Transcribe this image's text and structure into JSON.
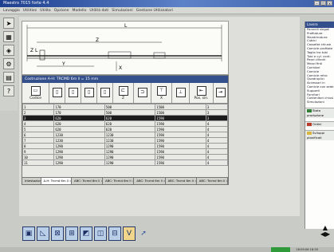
{
  "window": {
    "title": "Maestro 7015 forte 4.4"
  },
  "menu": {
    "items": [
      "Lavaggio",
      "Utilities",
      "Utilita",
      "Opzione",
      "Modello",
      "Utilità dati",
      "Simulazioni",
      "Gestione Utilizzatori"
    ]
  },
  "toolbar": {
    "icons": [
      "cursor-icon",
      "select-icon",
      "layers-icon",
      "settings-icon",
      "report-icon",
      "help-icon"
    ]
  },
  "drawing": {
    "dimension_labels": {
      "L": "L",
      "Z": "Z",
      "Y": "Y",
      "X": "X",
      "ZL": "Z L"
    }
  },
  "panel": {
    "title": "Costruzione A-H: TRCMD 6m ll = 15 mm",
    "columns": [
      "Codice",
      "",
      "",
      "",
      "",
      "Z",
      "",
      "X",
      "",
      "Pos. sin.",
      ""
    ],
    "rows": [
      [
        "1",
        "170",
        "500",
        "1500",
        "3"
      ],
      [
        "2",
        "170",
        "500",
        "1500",
        "3"
      ],
      [
        "3",
        "620",
        "620",
        "1590",
        "3"
      ],
      [
        "4",
        "620",
        "620",
        "1590",
        "4"
      ],
      [
        "5",
        "620",
        "620",
        "1590",
        "4"
      ],
      [
        "6",
        "1230",
        "1230",
        "1590",
        "4"
      ],
      [
        "7",
        "1230",
        "1230",
        "1590",
        "4"
      ],
      [
        "8",
        "1290",
        "1290",
        "1590",
        "4"
      ],
      [
        "9",
        "1290",
        "1290",
        "1590",
        "4"
      ],
      [
        "10",
        "1290",
        "1290",
        "1590",
        "4"
      ],
      [
        "11",
        "1290",
        "1290",
        "1590",
        "4"
      ]
    ],
    "selected_row": 2,
    "tabs": [
      "Intestazioni",
      "A-H: Trcmd 6m ll = 15",
      "ABC: Trcmd 6m ll = 15",
      "ABC: Trcmd 6m ll = 15",
      "ABC: Trcmd 6m ll = 15",
      "ABC: Trcmd 6m ll = 15",
      "ABC: Trcmd 6m ll = 15"
    ]
  },
  "rightpanel": {
    "title": "Lavora",
    "items": [
      "Pannelli singoli",
      "Profilature",
      "Mandrinatura",
      "Cubici",
      "Cassette chiuse",
      "Camicie profilate",
      "Taglio tra tubi",
      "Tubi e cyl. cont.",
      "Pezzi cilindri",
      "Mezzi finti",
      "Corridori",
      "Camicie",
      "Camicie retro",
      "Quadruplici",
      "Accessori in",
      "Camicie con sede",
      "Supporti",
      "Fornitori",
      "Contenitori chiusi",
      "Simulazioni"
    ],
    "sections": [
      {
        "label": "Stato produzione",
        "color": "#2f7f37"
      },
      {
        "label": "Ordini",
        "color": "#b83a2c"
      },
      {
        "label": "Sviluppi pianificati",
        "color": "#d7b640"
      }
    ]
  },
  "bottombar": {
    "buttons": [
      {
        "name": "frame-icon",
        "glyph": "▣",
        "style": "normal"
      },
      {
        "name": "triangle-icon",
        "glyph": "◺",
        "style": "normal"
      },
      {
        "name": "cross-frame-icon",
        "glyph": "⊠",
        "style": "normal"
      },
      {
        "name": "split-frame-icon",
        "glyph": "⊞",
        "style": "normal"
      },
      {
        "name": "diagonal-frame-icon",
        "glyph": "◩",
        "style": "normal"
      },
      {
        "name": "box-icon",
        "glyph": "◫",
        "style": "normal"
      },
      {
        "name": "window-icon",
        "glyph": "⊟",
        "style": "normal"
      },
      {
        "name": "validate-icon",
        "glyph": "V",
        "style": "gold"
      },
      {
        "name": "arrow-icon",
        "glyph": "➚",
        "style": "plain"
      }
    ]
  },
  "status": {
    "text": "18:09:06 18:35"
  }
}
